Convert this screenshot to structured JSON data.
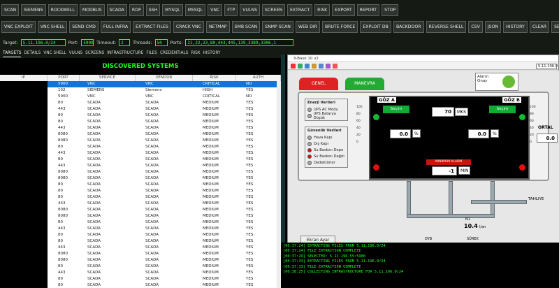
{
  "toolbar1": [
    "SCAN",
    "SIEMENS",
    "ROCKWELL",
    "MODBUS",
    "SCADA",
    "RDP",
    "SSH",
    "MYSQL",
    "MSSQL",
    "VNC",
    "FTP",
    "VULNS",
    "SCREEN",
    "EXTRACT",
    "RISK",
    "EXPORT",
    "REPORT",
    "STOP"
  ],
  "toolbar2": [
    "VNC EXPLOIT",
    "VNC SHELL",
    "SEND CMD",
    "FULL INFRA",
    "EXTRACT FILES",
    "CRACK VNC",
    "NETMAP",
    "SMB SCAN",
    "SNMP SCAN",
    "WEB DIR",
    "BRUTE FORCE",
    "EXPLOIT DB",
    "BACKDOOR",
    "REVERSE SHELL",
    "CSV",
    "JSON",
    "HISTORY",
    "CLEAR",
    "SETTINGS"
  ],
  "config": {
    "target_label": "Target:",
    "target": "5.11.196.0/24",
    "port_label": "Port:",
    "port": "5900",
    "timeout_label": "Timeout:",
    "timeout": "2",
    "threads_label": "Threads:",
    "threads": "50",
    "ports_label": "Ports:",
    "ports": "21,22,23,80,443,445,139,3389,3306,1"
  },
  "tabs": [
    "TARGETS",
    "DETAILS",
    "VNC SHELL",
    "VULNS",
    "SCREENS",
    "INFRASTRUCTURE",
    "FILES",
    "CREDENTIALS",
    "RISK",
    "HISTORY"
  ],
  "systems": {
    "title": "DISCOVERED SYSTEMS",
    "columns": [
      "IP",
      "PORT",
      "SERVICE",
      "VENDOR",
      "RISK",
      "AUTH"
    ],
    "rows": [
      [
        "5900",
        "VNC",
        "VNC",
        "CRITICAL",
        "NO"
      ],
      [
        "102",
        "SIEMENS",
        "Siemens",
        "HIGH",
        "YES"
      ],
      [
        "5900",
        "VNC",
        "VNC",
        "CRITICAL",
        "NO"
      ],
      [
        "80",
        "SCADA",
        "SCADA",
        "MEDIUM",
        "YES"
      ],
      [
        "443",
        "SCADA",
        "SCADA",
        "MEDIUM",
        "YES"
      ],
      [
        "80",
        "SCADA",
        "SCADA",
        "MEDIUM",
        "YES"
      ],
      [
        "80",
        "SCADA",
        "SCADA",
        "MEDIUM",
        "YES"
      ],
      [
        "443",
        "SCADA",
        "SCADA",
        "MEDIUM",
        "YES"
      ],
      [
        "8080",
        "SCADA",
        "SCADA",
        "MEDIUM",
        "YES"
      ],
      [
        "8080",
        "SCADA",
        "SCADA",
        "MEDIUM",
        "YES"
      ],
      [
        "80",
        "SCADA",
        "SCADA",
        "MEDIUM",
        "YES"
      ],
      [
        "443",
        "SCADA",
        "SCADA",
        "MEDIUM",
        "YES"
      ],
      [
        "80",
        "SCADA",
        "SCADA",
        "MEDIUM",
        "YES"
      ],
      [
        "443",
        "SCADA",
        "SCADA",
        "MEDIUM",
        "YES"
      ],
      [
        "8080",
        "SCADA",
        "SCADA",
        "MEDIUM",
        "YES"
      ],
      [
        "8080",
        "SCADA",
        "SCADA",
        "MEDIUM",
        "YES"
      ],
      [
        "80",
        "SCADA",
        "SCADA",
        "MEDIUM",
        "YES"
      ],
      [
        "80",
        "SCADA",
        "SCADA",
        "MEDIUM",
        "YES"
      ],
      [
        "80",
        "SCADA",
        "SCADA",
        "MEDIUM",
        "YES"
      ],
      [
        "443",
        "SCADA",
        "SCADA",
        "MEDIUM",
        "YES"
      ],
      [
        "8080",
        "SCADA",
        "SCADA",
        "MEDIUM",
        "YES"
      ],
      [
        "8080",
        "SCADA",
        "SCADA",
        "MEDIUM",
        "YES"
      ],
      [
        "80",
        "SCADA",
        "SCADA",
        "MEDIUM",
        "YES"
      ],
      [
        "443",
        "SCADA",
        "SCADA",
        "MEDIUM",
        "YES"
      ],
      [
        "80",
        "SCADA",
        "SCADA",
        "MEDIUM",
        "YES"
      ],
      [
        "80",
        "SCADA",
        "SCADA",
        "MEDIUM",
        "YES"
      ],
      [
        "443",
        "SCADA",
        "SCADA",
        "MEDIUM",
        "YES"
      ],
      [
        "8080",
        "SCADA",
        "SCADA",
        "MEDIUM",
        "YES"
      ],
      [
        "8080",
        "SCADA",
        "SCADA",
        "MEDIUM",
        "YES"
      ],
      [
        "80",
        "SCADA",
        "SCADA",
        "MEDIUM",
        "YES"
      ],
      [
        "443",
        "SCADA",
        "SCADA",
        "MEDIUM",
        "YES"
      ],
      [
        "80",
        "SCADA",
        "SCADA",
        "MEDIUM",
        "YES"
      ],
      [
        "80",
        "SCADA",
        "SCADA",
        "MEDIUM",
        "YES"
      ]
    ]
  },
  "hmi": {
    "window_title": "X-Base 10 v2",
    "address": "5.11.196.0",
    "tab_general": "GENEL",
    "tab_manevra": "MANEVRA",
    "alarm_label": "Alarm Onay",
    "energy_title": "Enerji Verileri",
    "energy_items": [
      "UPS AC Modu",
      "UPS Batarya Düşük"
    ],
    "security_title": "Güvenlik Verileri",
    "security_items": [
      "Hava Kapı",
      "Dış Kapı",
      "Su Baskını Depo",
      "Su Baskını Dağıtı",
      "Dedektörler"
    ],
    "tank_a": "GÖZ A",
    "tank_b": "GÖZ B",
    "btn_secim_a": "Seçim",
    "btn_secim_b": "Seçim",
    "level_value": "70",
    "level_unit": "MKS",
    "pct_a": "0.0",
    "pct_b": "0.0",
    "pct_unit": "%",
    "min_label": "MINIMUM ALARM",
    "min_value": "-1",
    "min_unit": "MIN",
    "ortala_label": "ORTAL",
    "ortala_value": "0.0",
    "scale": [
      "100",
      "80",
      "60",
      "40",
      "20",
      "0"
    ],
    "tahliye": "TAHLIYE",
    "flow_value": "10.4",
    "flow_unit": "l/an",
    "label_n1": "N1",
    "label_dyb": "DYB",
    "label_sure": "SÜREK",
    "ekran": "Ekran Ayar"
  },
  "log": [
    "[00:37:24] EXTRACTING FILES FROM 5.11.196.0/24",
    "[00:37:24] FILE EXTRACTION COMPLETE",
    "[00:37:29] SELECTED: 5.11.196.55:5900",
    "[00:37:33] EXTRACTING FILES FROM 5.11.196.0/24",
    "[00:37:33] FILE EXTRACTION COMPLETE",
    "[00:38:25] COLLECTING INFRASTRUCTURE FOR 5.11.196.0/24"
  ]
}
